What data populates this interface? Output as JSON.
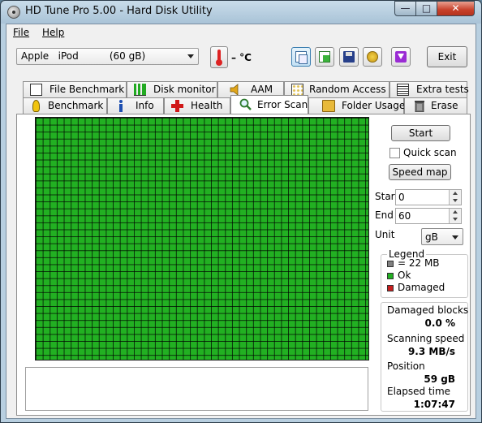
{
  "window": {
    "title": "HD Tune Pro 5.00 - Hard Disk Utility"
  },
  "menu": {
    "file": "File",
    "help": "Help"
  },
  "toolbar": {
    "drive": "Apple   iPod          (60 gB)",
    "temperature": "– °C",
    "exit_label": "Exit"
  },
  "tabs_top": [
    {
      "label": "File Benchmark",
      "icon": "file-benchmark-icon"
    },
    {
      "label": "Disk monitor",
      "icon": "disk-monitor-icon"
    },
    {
      "label": "AAM",
      "icon": "speaker-icon"
    },
    {
      "label": "Random Access",
      "icon": "random-access-icon"
    },
    {
      "label": "Extra tests",
      "icon": "extra-tests-icon"
    }
  ],
  "tabs_bottom": [
    {
      "label": "Benchmark",
      "icon": "lightbulb-icon"
    },
    {
      "label": "Info",
      "icon": "info-icon"
    },
    {
      "label": "Health",
      "icon": "health-cross-icon"
    },
    {
      "label": "Error Scan",
      "icon": "magnifier-icon",
      "selected": true
    },
    {
      "label": "Folder Usage",
      "icon": "folder-icon"
    },
    {
      "label": "Erase",
      "icon": "trash-icon"
    }
  ],
  "scan": {
    "start_button": "Start",
    "quick_scan_label": "Quick scan",
    "quick_scan_checked": false,
    "speed_map_button": "Speed map",
    "start_label": "Start",
    "start_value": "0",
    "end_label": "End",
    "end_value": "60",
    "unit_label": "Unit",
    "unit_value": "gB"
  },
  "legend": {
    "title": "Legend",
    "block_size": "= 22 MB",
    "ok": "Ok",
    "damaged": "Damaged",
    "colors": {
      "block": "#808080",
      "ok": "#22b022",
      "damaged": "#c81e1e"
    }
  },
  "stats": {
    "damaged_blocks_label": "Damaged blocks",
    "damaged_blocks_value": "0.0 %",
    "scanning_speed_label": "Scanning speed",
    "scanning_speed_value": "9.3 MB/s",
    "position_label": "Position",
    "position_value": "59 gB",
    "elapsed_label": "Elapsed time",
    "elapsed_value": "1:07:47"
  }
}
